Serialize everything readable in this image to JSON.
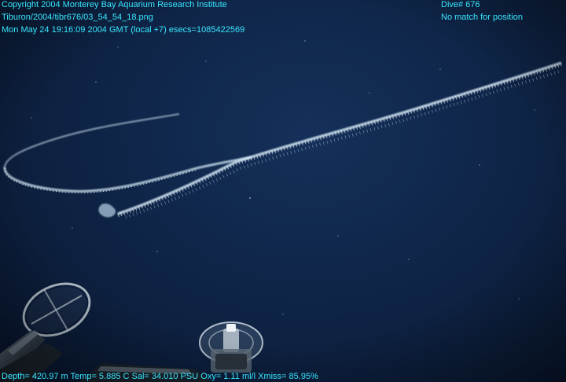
{
  "overlay": {
    "copyright": "Copyright 2004 Monterey Bay Aquarium Research Institute",
    "file_path": "Tiburon/2004/tibr676/03_54_54_18.png",
    "timestamp": "Mon May 24 19:16:09 2004 GMT (local +7)  esecs=1085422569",
    "dive": "Dive# 676",
    "position_status": "No match for position",
    "telemetry": "Depth= 420.97 m  Temp= 5.885 C  Sal= 34.010 PSU  Oxy= 1.11 ml/l  Xmiss= 85.95%"
  },
  "colors": {
    "overlay_text": "#39e6ff",
    "water_deep": "#0a1a33",
    "water_mid": "#14305a",
    "siphonophore": "#cfe4f2"
  },
  "scene": {
    "subject": "siphonophore",
    "equipment": [
      "sampler-left",
      "sampler-center"
    ]
  }
}
